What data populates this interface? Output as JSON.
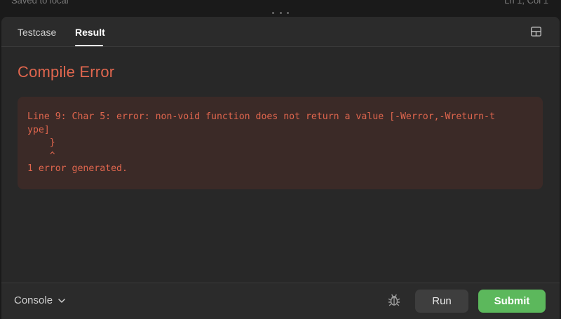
{
  "top": {
    "left_status": "Saved to local",
    "right_status": "Ln 1, Col 1"
  },
  "tabs": [
    {
      "label": "Testcase",
      "active": false
    },
    {
      "label": "Result",
      "active": true
    }
  ],
  "result": {
    "title": "Compile Error",
    "error_lines": [
      "Line 9: Char 5: error: non-void function does not return a value [-Werror,-Wreturn-t",
      "ype]",
      "    }",
      "    ^",
      "1 error generated."
    ]
  },
  "bottom": {
    "console_label": "Console",
    "run_label": "Run",
    "submit_label": "Submit"
  },
  "icons": {
    "layout": "layout-panel-icon",
    "chevron": "chevron-down-icon",
    "debug": "bug-icon"
  },
  "colors": {
    "error": "#e0664e",
    "error_bg": "#3b2a27",
    "submit": "#5cb85c"
  }
}
